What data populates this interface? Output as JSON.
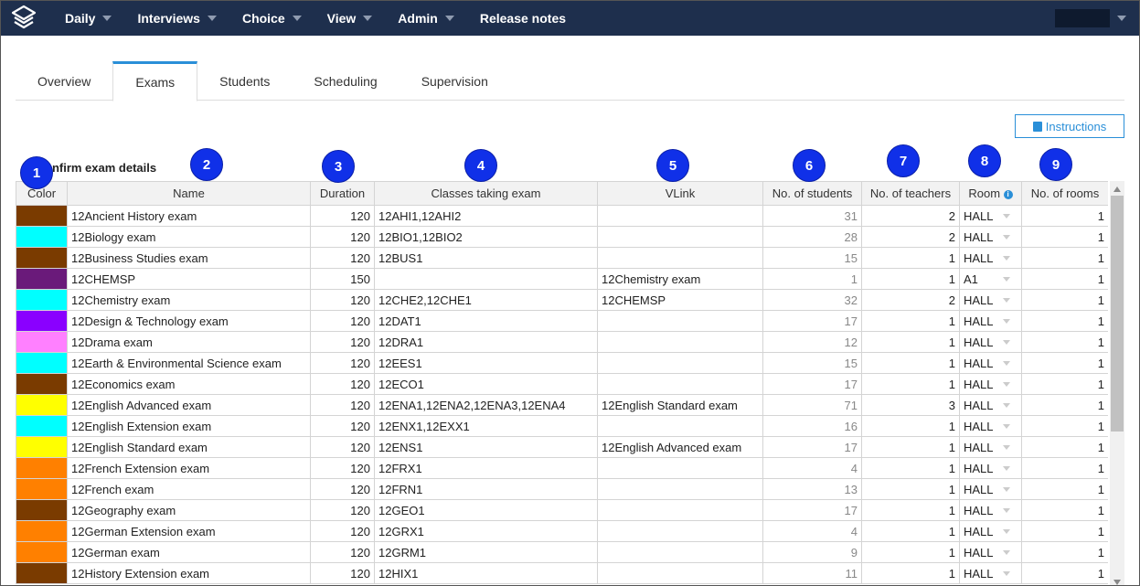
{
  "nav": {
    "items": [
      {
        "label": "Daily",
        "caret": true
      },
      {
        "label": "Interviews",
        "caret": true
      },
      {
        "label": "Choice",
        "caret": true
      },
      {
        "label": "View",
        "caret": true
      },
      {
        "label": "Admin",
        "caret": true
      },
      {
        "label": "Release notes",
        "caret": false
      }
    ]
  },
  "tabs": [
    {
      "label": "Overview",
      "active": false
    },
    {
      "label": "Exams",
      "active": true
    },
    {
      "label": "Students",
      "active": false
    },
    {
      "label": "Scheduling",
      "active": false
    },
    {
      "label": "Supervision",
      "active": false
    }
  ],
  "instructions_label": "Instructions",
  "section_title": "onfirm exam details",
  "callouts": [
    "1",
    "2",
    "3",
    "4",
    "5",
    "6",
    "7",
    "8",
    "9"
  ],
  "columns": {
    "color": "Color",
    "name": "Name",
    "duration": "Duration",
    "classes": "Classes taking exam",
    "vlink": "VLink",
    "students": "No. of students",
    "teachers": "No. of teachers",
    "room": "Room",
    "rooms": "No. of rooms"
  },
  "rows": [
    {
      "color": "#7a3b00",
      "name": "12Ancient History exam",
      "duration": "120",
      "classes": "12AHI1,12AHI2",
      "vlink": "",
      "students": "31",
      "teachers": "2",
      "room": "HALL",
      "rooms": "1"
    },
    {
      "color": "#00ffff",
      "name": "12Biology exam",
      "duration": "120",
      "classes": "12BIO1,12BIO2",
      "vlink": "",
      "students": "28",
      "teachers": "2",
      "room": "HALL",
      "rooms": "1"
    },
    {
      "color": "#7a3b00",
      "name": "12Business Studies exam",
      "duration": "120",
      "classes": "12BUS1",
      "vlink": "",
      "students": "15",
      "teachers": "1",
      "room": "HALL",
      "rooms": "1"
    },
    {
      "color": "#6a1a7a",
      "name": "12CHEMSP",
      "duration": "150",
      "classes": "",
      "vlink": "12Chemistry exam",
      "students": "1",
      "teachers": "1",
      "room": "A1",
      "rooms": "1"
    },
    {
      "color": "#00ffff",
      "name": "12Chemistry exam",
      "duration": "120",
      "classes": "12CHE2,12CHE1",
      "vlink": "12CHEMSP",
      "students": "32",
      "teachers": "2",
      "room": "HALL",
      "rooms": "1"
    },
    {
      "color": "#8a00ff",
      "name": "12Design & Technology exam",
      "duration": "120",
      "classes": "12DAT1",
      "vlink": "",
      "students": "17",
      "teachers": "1",
      "room": "HALL",
      "rooms": "1"
    },
    {
      "color": "#ff80ff",
      "name": "12Drama exam",
      "duration": "120",
      "classes": "12DRA1",
      "vlink": "",
      "students": "12",
      "teachers": "1",
      "room": "HALL",
      "rooms": "1"
    },
    {
      "color": "#00ffff",
      "name": "12Earth & Environmental Science exam",
      "duration": "120",
      "classes": "12EES1",
      "vlink": "",
      "students": "15",
      "teachers": "1",
      "room": "HALL",
      "rooms": "1"
    },
    {
      "color": "#7a3b00",
      "name": "12Economics exam",
      "duration": "120",
      "classes": "12ECO1",
      "vlink": "",
      "students": "17",
      "teachers": "1",
      "room": "HALL",
      "rooms": "1"
    },
    {
      "color": "#ffff00",
      "name": "12English Advanced exam",
      "duration": "120",
      "classes": "12ENA1,12ENA2,12ENA3,12ENA4",
      "vlink": "12English Standard exam",
      "students": "71",
      "teachers": "3",
      "room": "HALL",
      "rooms": "1"
    },
    {
      "color": "#00ffff",
      "name": "12English Extension exam",
      "duration": "120",
      "classes": "12ENX1,12EXX1",
      "vlink": "",
      "students": "16",
      "teachers": "1",
      "room": "HALL",
      "rooms": "1"
    },
    {
      "color": "#ffff00",
      "name": "12English Standard exam",
      "duration": "120",
      "classes": "12ENS1",
      "vlink": "12English Advanced exam",
      "students": "17",
      "teachers": "1",
      "room": "HALL",
      "rooms": "1"
    },
    {
      "color": "#ff8000",
      "name": "12French Extension exam",
      "duration": "120",
      "classes": "12FRX1",
      "vlink": "",
      "students": "4",
      "teachers": "1",
      "room": "HALL",
      "rooms": "1"
    },
    {
      "color": "#ff8000",
      "name": "12French exam",
      "duration": "120",
      "classes": "12FRN1",
      "vlink": "",
      "students": "13",
      "teachers": "1",
      "room": "HALL",
      "rooms": "1"
    },
    {
      "color": "#7a3b00",
      "name": "12Geography exam",
      "duration": "120",
      "classes": "12GEO1",
      "vlink": "",
      "students": "17",
      "teachers": "1",
      "room": "HALL",
      "rooms": "1"
    },
    {
      "color": "#ff8000",
      "name": "12German Extension exam",
      "duration": "120",
      "classes": "12GRX1",
      "vlink": "",
      "students": "4",
      "teachers": "1",
      "room": "HALL",
      "rooms": "1"
    },
    {
      "color": "#ff8000",
      "name": "12German exam",
      "duration": "120",
      "classes": "12GRM1",
      "vlink": "",
      "students": "9",
      "teachers": "1",
      "room": "HALL",
      "rooms": "1"
    },
    {
      "color": "#7a3b00",
      "name": "12History Extension exam",
      "duration": "120",
      "classes": "12HIX1",
      "vlink": "",
      "students": "11",
      "teachers": "1",
      "room": "HALL",
      "rooms": "1"
    }
  ]
}
